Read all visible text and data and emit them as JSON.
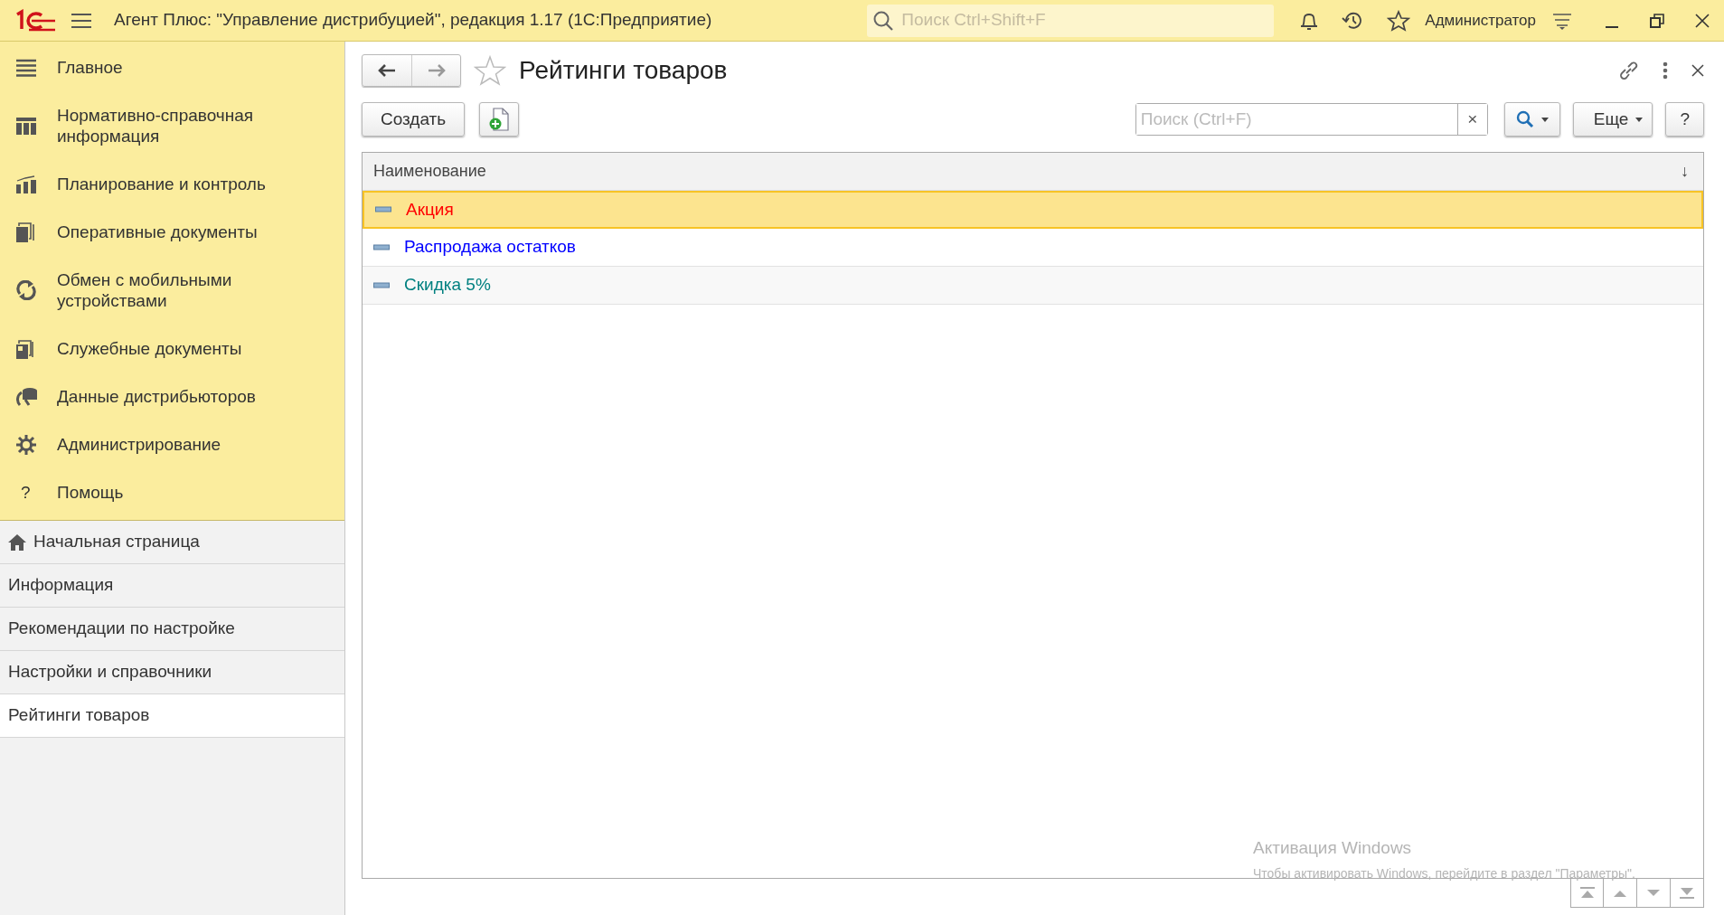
{
  "window": {
    "title": "Агент Плюс: \"Управление дистрибуцией\", редакция 1.17  (1С:Предприятие)",
    "search": {
      "placeholder": "Поиск Ctrl+Shift+F"
    },
    "user": "Администратор"
  },
  "sections": [
    {
      "label": "Главное"
    },
    {
      "label": "Нормативно-справочная информация"
    },
    {
      "label": "Планирование и контроль"
    },
    {
      "label": "Оперативные документы"
    },
    {
      "label": "Обмен с мобильными устройствами"
    },
    {
      "label": "Служебные документы"
    },
    {
      "label": "Данные дистрибьюторов"
    },
    {
      "label": "Администрирование"
    },
    {
      "label": "Помощь",
      "icon_text": "?"
    }
  ],
  "open_windows": [
    {
      "label": "Начальная страница",
      "kind": "home",
      "selected": false
    },
    {
      "label": "Информация",
      "kind": "window",
      "selected": false
    },
    {
      "label": "Рекомендации по настройке",
      "kind": "window",
      "selected": false
    },
    {
      "label": "Настройки и справочники",
      "kind": "window",
      "selected": false
    },
    {
      "label": "Рейтинги товаров",
      "kind": "window",
      "selected": true
    }
  ],
  "form": {
    "title": "Рейтинги товаров",
    "create_button": "Создать",
    "search": {
      "placeholder": "Поиск (Ctrl+F)"
    },
    "clear_button": "×",
    "more_button": "Еще",
    "help_button": "?"
  },
  "table": {
    "columns": [
      {
        "label": "Наименование",
        "sort_mark": "↓"
      }
    ],
    "rows": [
      {
        "name": "Акция",
        "color": "#ff0000",
        "selected": true
      },
      {
        "name": "Распродажа остатков",
        "color": "#0000ff",
        "selected": false
      },
      {
        "name": "Скидка 5%",
        "color": "#008080",
        "selected": false
      }
    ]
  },
  "os_overlay": {
    "title": "Активация Windows",
    "text": "Чтобы активировать Windows, перейдите в раздел \"Параметры\"."
  }
}
